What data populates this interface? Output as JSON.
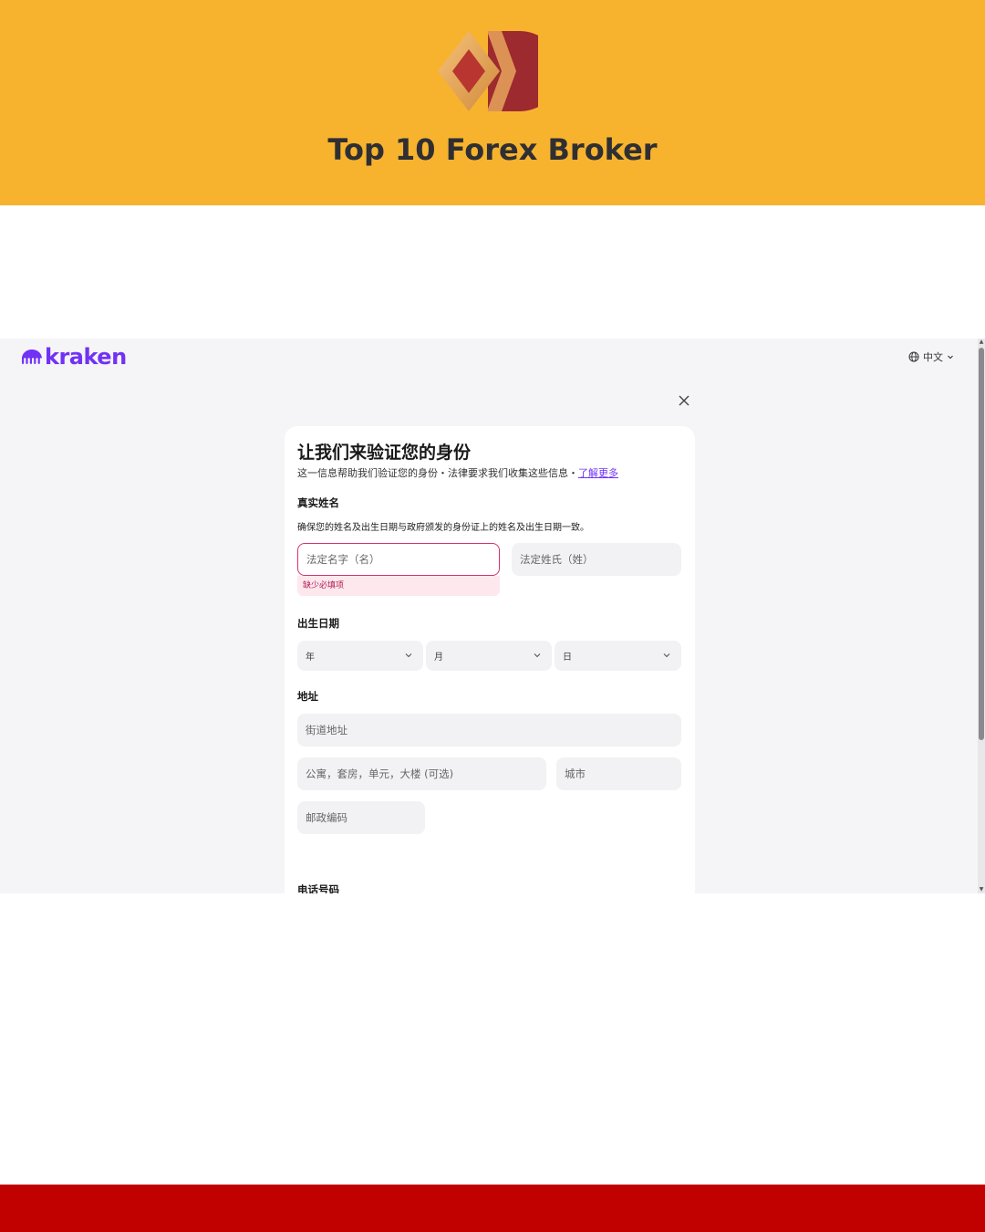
{
  "banner": {
    "title": "Top 10 Forex Broker",
    "bg_color": "#f7b32e"
  },
  "app": {
    "brand": "kraken",
    "brand_color": "#7132f5",
    "language": "中文",
    "close_icon": "close-icon"
  },
  "form": {
    "title": "让我们来验证您的身份",
    "subtitle": "这一信息帮助我们验证您的身份・法律要求我们收集这些信息・",
    "learn_more": "了解更多",
    "name_section": {
      "label": "真实姓名",
      "hint": "确保您的姓名及出生日期与政府颁发的身份证上的姓名及出生日期一致。",
      "first_name_placeholder": "法定名字（名）",
      "last_name_placeholder": "法定姓氏（姓）",
      "error": "缺少必填项"
    },
    "dob_section": {
      "label": "出生日期",
      "year": "年",
      "month": "月",
      "day": "日"
    },
    "address_section": {
      "label": "地址",
      "street_placeholder": "街道地址",
      "unit_placeholder": "公寓，套房，单元，大楼 (可选)",
      "city_placeholder": "城市",
      "postal_placeholder": "邮政编码"
    },
    "phone_section": {
      "label": "电话号码"
    }
  },
  "footer": {
    "bar_color": "#c10000"
  }
}
